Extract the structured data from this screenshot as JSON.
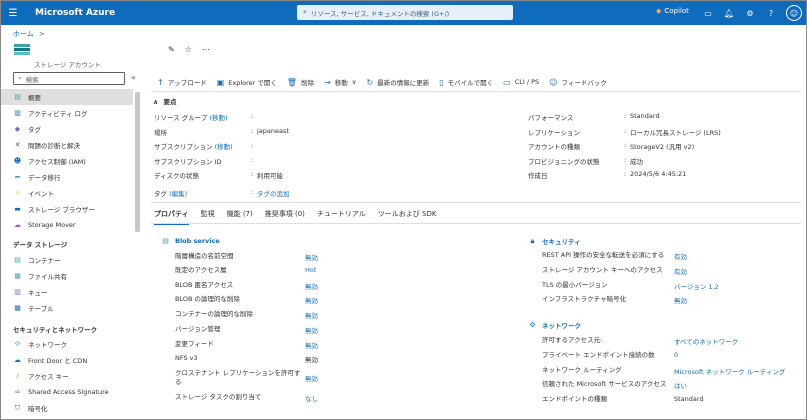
{
  "app": {
    "title": "Microsoft Azure",
    "search_placeholder": "リソース, サービス, ドキュメントの検索 (G+/)",
    "copilot_label": "Copilot",
    "accent": "#0f6cbd"
  },
  "breadcrumb": {
    "home": "ホーム",
    "separator": ">"
  },
  "resource": {
    "type": "ストレージ アカウント"
  },
  "sidebar": {
    "search_placeholder": "検索",
    "items": [
      {
        "label": "概要",
        "icon": "overview-icon"
      },
      {
        "label": "アクティビティ ログ",
        "icon": "activity-log-icon"
      },
      {
        "label": "タグ",
        "icon": "tag-icon"
      },
      {
        "label": "問題の診断と解決",
        "icon": "wrench-icon"
      },
      {
        "label": "アクセス制御 (IAM)",
        "icon": "people-icon"
      },
      {
        "label": "データ移行",
        "icon": "migrate-icon"
      },
      {
        "label": "イベント",
        "icon": "lightning-icon"
      },
      {
        "label": "ストレージ ブラウザー",
        "icon": "folder-icon"
      },
      {
        "label": "Storage Mover",
        "icon": "mover-icon"
      }
    ],
    "section_data": "データ ストレージ",
    "data_items": [
      {
        "label": "コンテナー",
        "icon": "container-icon"
      },
      {
        "label": "ファイル共有",
        "icon": "file-share-icon"
      },
      {
        "label": "キュー",
        "icon": "queue-icon"
      },
      {
        "label": "テーブル",
        "icon": "table-icon"
      }
    ],
    "section_security": "セキュリティとネットワーク",
    "security_items": [
      {
        "label": "ネットワーク",
        "icon": "network-icon"
      },
      {
        "label": "Front Door と CDN",
        "icon": "cloud-icon"
      },
      {
        "label": "アクセス キー",
        "icon": "key-icon"
      },
      {
        "label": "Shared Access Signature",
        "icon": "link-icon"
      },
      {
        "label": "暗号化",
        "icon": "shield-icon"
      }
    ]
  },
  "toolbar": {
    "upload": "アップロード",
    "explorer": "Explorer で開く",
    "delete": "削除",
    "move": "移動",
    "refresh": "最新の情報に更新",
    "mobile": "モバイルで開く",
    "cli": "CLI / PS",
    "feedback": "フィードバック"
  },
  "essentials": {
    "title": "要点",
    "left": [
      {
        "label": "リソース グループ",
        "label_link": "(移動)",
        "value": ""
      },
      {
        "label": "場所",
        "value": "japaneast"
      },
      {
        "label": "サブスクリプション",
        "label_link": "(移動)",
        "value": ""
      },
      {
        "label": "サブスクリプション ID",
        "value": ""
      },
      {
        "label": "ディスクの状態",
        "value": "利用可能"
      }
    ],
    "right": [
      {
        "label": "パフォーマンス",
        "value": "Standard"
      },
      {
        "label": "レプリケーション",
        "value": "ローカル冗長ストレージ (LRS)"
      },
      {
        "label": "アカウントの種類",
        "value": "StorageV2 (汎用 v2)"
      },
      {
        "label": "プロビジョニングの状態",
        "value": "成功"
      },
      {
        "label": "作成日",
        "value": "2024/5/6 4:45:21"
      }
    ],
    "tags_label": "タグ",
    "tags_edit": "(編集)",
    "tags_add": "タグの追加"
  },
  "tabs": [
    "プロパティ",
    "監視",
    "機能 (7)",
    "推奨事項 (0)",
    "チュートリアル",
    "ツールおよび SDK"
  ],
  "blob": {
    "title": "Blob service",
    "rows": [
      {
        "label": "階層構造の名前空間",
        "value": "無効",
        "link": true
      },
      {
        "label": "既定のアクセス層",
        "value": "Hot",
        "link": true
      },
      {
        "label": "BLOB 匿名アクセス",
        "value": "無効",
        "link": true
      },
      {
        "label": "BLOB の論理的な削除",
        "value": "無効",
        "link": true
      },
      {
        "label": "コンテナーの論理的な削除",
        "value": "無効",
        "link": true
      },
      {
        "label": "バージョン管理",
        "value": "無効",
        "link": true
      },
      {
        "label": "変更フィード",
        "value": "無効",
        "link": true
      },
      {
        "label": "NFS v3",
        "value": "無効",
        "link": false
      },
      {
        "label": "クロステナント レプリケーションを許可する",
        "value": "無効",
        "link": true
      },
      {
        "label": "ストレージ タスクの割り当て",
        "value": "なし",
        "link": true
      }
    ]
  },
  "security": {
    "title": "セキュリティ",
    "rows": [
      {
        "label": "REST API 操作の安全な転送を必須にする",
        "value": "有効"
      },
      {
        "label": "ストレージ アカウント キーへのアクセス",
        "value": "有効"
      },
      {
        "label": "TLS の最小バージョン",
        "value": "バージョン 1.2"
      },
      {
        "label": "インフラストラクチャ暗号化",
        "value": "無効"
      }
    ]
  },
  "network": {
    "title": "ネットワーク",
    "rows": [
      {
        "label": "許可するアクセス元:",
        "value": "すべてのネットワーク",
        "link": true
      },
      {
        "label": "プライベート エンドポイント接続の数",
        "value": "0",
        "link": true
      },
      {
        "label": "ネットワーク ルーティング",
        "value": "Microsoft ネットワーク ルーティング",
        "link": true
      },
      {
        "label": "信頼された Microsoft サービスのアクセス",
        "value": "はい",
        "link": true
      },
      {
        "label": "エンドポイントの種類",
        "value": "Standard",
        "link": false
      }
    ]
  }
}
